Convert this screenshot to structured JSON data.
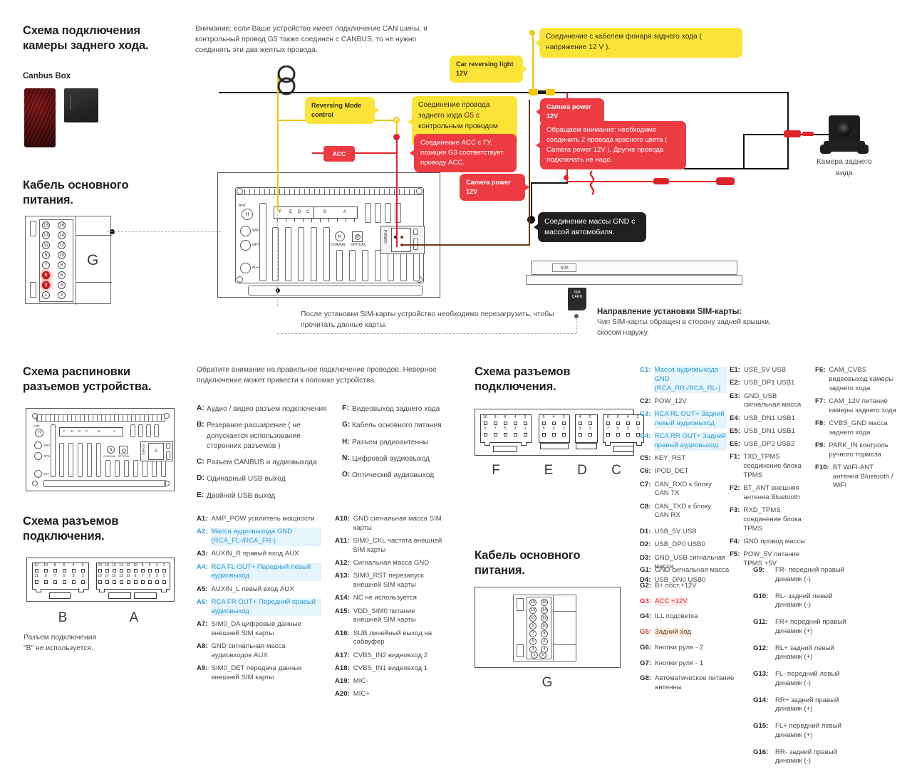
{
  "sections": {
    "rear_camera": {
      "title": "Схема подключения\nкамеры заднего хода.",
      "canbus_label": "Canbus Box",
      "warning": "Внимание: если Ваше устройство имеет подключение CAN шины, и контрольный провод G5 также соединен с CANBUS, то не нужно соединять эти два желтых провода.",
      "camera_caption": "Камера заднего\nвида"
    },
    "main_power_cable_top": {
      "title": "Кабель основного\nпитания.",
      "connector_letter": "G"
    },
    "sim": {
      "note": "После установки SIM-карты устройство необходимо перезагрузить, чтобы прочитать данные карты.",
      "direction_title": "Направление установки SIM-карты:",
      "direction_text": "Чип SIM-карты обращен в сторону задней крышки, скосом наружу.",
      "tray_label": "SIM",
      "chip_label": "SIM\nCARD"
    },
    "pinout": {
      "title": "Схема распиновки\nразъемов устройства.",
      "note": "Обратите внимание на правильное подключение проводов. Неверное подключение может привести к поломке устройства."
    },
    "connectors_right": {
      "title": "Схема разъемов\nподключения.",
      "letters": [
        "F",
        "E",
        "D",
        "C"
      ]
    },
    "connectors_left": {
      "title": "Схема разъемов\nподключения.",
      "letters": [
        "B",
        "A"
      ],
      "footnote": "Разъем подключения\n\"B\" не используется."
    },
    "main_power_cable_bottom": {
      "title": "Кабель основного\nпитания.",
      "connector_letter": "G"
    }
  },
  "callouts": {
    "reverse_lamp_12v": "Соединение с кабелем фонаря заднего хода ( напряжение 12 V ).",
    "car_reversing_light": "Car reversing light 12V",
    "reversing_mode_control": "Reversing Mode control",
    "g5_control_wire": "Соединение провода заднего хода G5 с контрольным проводом заднего хода.",
    "acc_note": "Соединение ACC с ГУ, позиция G3 соответствует проводу ACC.",
    "acc_tag": "ACC",
    "camera_power_top": "Camera power 12V",
    "camera_power_bottom": "Camera power 12V",
    "two_red_wires": "Обращаем внимание: необходимо соединить 2 провода красного цвета ( Camera power 12V ). Другие провода подключать не надо.",
    "gnd_note": "Соединение массы GND с массой автомобиля."
  },
  "device_labels": {
    "ant": "ANT",
    "antenna_pin": "H",
    "wifi": "WIFI",
    "gps": "GPS",
    "fourg": "4G+",
    "coaxial": "COAXIAL",
    "optical": "OPTICAL",
    "coaxial_pin": "N",
    "optical_pin": "O",
    "power": "POWER",
    "port_letters": [
      "F",
      "E",
      "D",
      "C",
      "B",
      "A"
    ]
  },
  "legend_abc": [
    {
      "key": "A:",
      "val": "Аудио / видео разъем подключения"
    },
    {
      "key": "B:",
      "val": "Резервное расширение ( не допускается использование сторонних разъемов )"
    },
    {
      "key": "C:",
      "val": "Разъем CANBUS и аудиовыхода"
    },
    {
      "key": "D:",
      "val": "Одинарный USB выход"
    },
    {
      "key": "E:",
      "val": "Двойной USB выход"
    }
  ],
  "legend_fgh": [
    {
      "key": "F:",
      "val": "Видеовыход заднего хода"
    },
    {
      "key": "G:",
      "val": "Кабель основного питания"
    },
    {
      "key": "H:",
      "val": "Разъем радиоантенны"
    },
    {
      "key": "N:",
      "val": "Цифровой аудиовыход"
    },
    {
      "key": "O:",
      "val": "Оптический аудиовыход"
    }
  ],
  "pins_C_D": [
    {
      "key": "C1:",
      "val": "Масса аудиовыхода GND (RCA_RR-/RCA_RL-)",
      "style": "hl"
    },
    {
      "key": "C2:",
      "val": "POW_12V",
      "style": ""
    },
    {
      "key": "C3:",
      "val": "RCA RL OUT+ Задний левый аудиовыход",
      "style": "hl"
    },
    {
      "key": "C4:",
      "val": "RCA RR OUT+ Задний правый аудиовыход",
      "style": "hl"
    },
    {
      "key": "C5:",
      "val": "KEY_RST",
      "style": ""
    },
    {
      "key": "C6:",
      "val": "IPOD_DET",
      "style": ""
    },
    {
      "key": "C7:",
      "val": "CAN_RXD к блоку CAN TX",
      "style": ""
    },
    {
      "key": "C8:",
      "val": "CAN_TXD к блоку CAN RX",
      "style": ""
    },
    {
      "key": "D1:",
      "val": "USB_5V USB",
      "style": ""
    },
    {
      "key": "D2:",
      "val": "USB_DP0 USB0",
      "style": ""
    },
    {
      "key": "D3:",
      "val": "GND_USB сигнальная масса",
      "style": ""
    },
    {
      "key": "D4:",
      "val": "USB_DN0 USB0",
      "style": ""
    }
  ],
  "pins_E_F": [
    {
      "key": "E1:",
      "val": "USB_5V USB",
      "style": ""
    },
    {
      "key": "E2:",
      "val": "USB_DP1 USB1",
      "style": ""
    },
    {
      "key": "E3:",
      "val": "GND_USB сигнальная масса",
      "style": ""
    },
    {
      "key": "E4:",
      "val": "USB_DN1 USB1",
      "style": ""
    },
    {
      "key": "E5:",
      "val": "USB_DN1 USB1",
      "style": ""
    },
    {
      "key": "E6:",
      "val": "USB_DP2 USB2",
      "style": ""
    },
    {
      "key": "F1:",
      "val": "TXD_TPMS соединение блока TPMS",
      "style": ""
    },
    {
      "key": "F2:",
      "val": "BT_ANT внешняя антенна Bluetooth",
      "style": ""
    },
    {
      "key": "F3:",
      "val": "RXD_TPMS соединение блока TPMS",
      "style": ""
    },
    {
      "key": "F4:",
      "val": "GND провод массы",
      "style": ""
    },
    {
      "key": "F5:",
      "val": "POW_5V питание TPMS +5V",
      "style": ""
    }
  ],
  "pins_F_right": [
    {
      "key": "F6:",
      "val": "CAM_CVBS видеовыход камеры заднего хода",
      "style": ""
    },
    {
      "key": "F7:",
      "val": "CAM_12V питание камеры заднего хода",
      "style": ""
    },
    {
      "key": "F8:",
      "val": "CVBS_GND масса заднего хода",
      "style": ""
    },
    {
      "key": "F9:",
      "val": "PARK_IN контроль ручного тормоза",
      "style": ""
    },
    {
      "key": "F10:",
      "val": "BT WIFI-ANT антенна Bluetooth / WiFi",
      "style": ""
    }
  ],
  "pins_A_left": [
    {
      "key": "A1:",
      "val": "AMP_POW усилитель мощности",
      "style": ""
    },
    {
      "key": "A2:",
      "val": "Масса аудиовыхода GND (RCA_FL-/RCA_FR-)",
      "style": "hl"
    },
    {
      "key": "A3:",
      "val": "AUXIN_R правый вход AUX",
      "style": ""
    },
    {
      "key": "A4:",
      "val": "RCA FL OUT+ Передний левый аудиовыход",
      "style": "hl"
    },
    {
      "key": "A5:",
      "val": "AUXIN_L левый вход AUX",
      "style": ""
    },
    {
      "key": "A6:",
      "val": "RCA FR OUT+ Передний правый аудиовыход",
      "style": "hl"
    },
    {
      "key": "A7:",
      "val": "SIM0_DA цифровые данные внешней SIM карты",
      "style": ""
    },
    {
      "key": "A8:",
      "val": "GND сигнальная масса аудиовходов AUX",
      "style": ""
    },
    {
      "key": "A9:",
      "val": "SIM0_DET передача данных внешней SIM карты",
      "style": ""
    }
  ],
  "pins_A_right": [
    {
      "key": "A10:",
      "val": "GND сигнальная масса SIM карты",
      "style": ""
    },
    {
      "key": "A11:",
      "val": "SIM0_CKL частота внешней SIM карты",
      "style": ""
    },
    {
      "key": "A12:",
      "val": "Сигнальная масса GND",
      "style": ""
    },
    {
      "key": "A13:",
      "val": "SIM0_RST перезапуск внешней SIM карты",
      "style": ""
    },
    {
      "key": "A14:",
      "val": "NC  не используется",
      "style": ""
    },
    {
      "key": "A15:",
      "val": "VDD_SIM0 питание внешней SIM карты",
      "style": ""
    },
    {
      "key": "A16:",
      "val": "SUB линейный выход на сабвуфер",
      "style": ""
    },
    {
      "key": "A17:",
      "val": "CVBS_IN2 видеовход 2",
      "style": ""
    },
    {
      "key": "A18:",
      "val": "CVBS_IN1 видеовход 1",
      "style": ""
    },
    {
      "key": "A19:",
      "val": "MIC-",
      "style": ""
    },
    {
      "key": "A20:",
      "val": "MIC+",
      "style": ""
    }
  ],
  "pins_G_left": [
    {
      "key": "G1:",
      "val": "GND сигнальная масса",
      "style": ""
    },
    {
      "key": "G2:",
      "val": "B+ пост.+12V",
      "style": ""
    },
    {
      "key": "G3:",
      "val": "ACC +12V",
      "style": "red"
    },
    {
      "key": "G4:",
      "val": "ILL подсветка",
      "style": ""
    },
    {
      "key": "G5:",
      "val": "Задний ход",
      "style": "redplain"
    },
    {
      "key": "G6:",
      "val": "Кнопки руля - 2",
      "style": ""
    },
    {
      "key": "G7:",
      "val": "Кнопки руля - 1",
      "style": ""
    },
    {
      "key": "G8:",
      "val": "Автоматическое питание антенны",
      "style": ""
    }
  ],
  "pins_G_right": [
    {
      "key": "G9:",
      "val": "FR- передний правый динамик (-)",
      "style": ""
    },
    {
      "key": "G10:",
      "val": "RL- задний левый динамик (-)",
      "style": ""
    },
    {
      "key": "G11:",
      "val": "FR+ передний правый динамик (+)",
      "style": ""
    },
    {
      "key": "G12:",
      "val": "RL+ задний левый динамик (+)",
      "style": ""
    },
    {
      "key": "G13:",
      "val": "FL- передний левый динамик (-)",
      "style": ""
    },
    {
      "key": "G14:",
      "val": "RR+ задний правый динамик (+)",
      "style": ""
    },
    {
      "key": "G15:",
      "val": "FL+ передний левый динамик (+)",
      "style": ""
    },
    {
      "key": "G16:",
      "val": "RR- задний правый динамик (-)",
      "style": ""
    }
  ],
  "pin_numbers": {
    "g_left_col": [
      "15",
      "13",
      "11",
      "9",
      "7",
      "5",
      "3",
      "1"
    ],
    "g_right_col": [
      "16",
      "14",
      "12",
      "10",
      "8",
      "6",
      "4",
      "2"
    ],
    "highlighted": [
      "5",
      "3"
    ],
    "conn_F_top": [
      "10",
      "8",
      "6",
      "4",
      "2"
    ],
    "conn_F_bottom": [
      "9",
      "7",
      "5",
      "3",
      "1"
    ],
    "conn_E_top": [
      "6",
      "4",
      "2"
    ],
    "conn_E_bottom": [
      "5",
      "3",
      "1"
    ],
    "conn_D_top": [
      "4",
      "2"
    ],
    "conn_D_bottom": [
      "3",
      "1"
    ],
    "conn_C_top": [
      "8",
      "6",
      "4",
      "2"
    ],
    "conn_C_bottom": [
      "7",
      "5",
      "3",
      "1"
    ],
    "conn_B_top": [
      "12",
      "10",
      "8",
      "6",
      "4",
      "2"
    ],
    "conn_B_bottom": [
      "11",
      "9",
      "7",
      "5",
      "3",
      "1"
    ],
    "conn_A_top": [
      "20",
      "18",
      "16",
      "14",
      "12",
      "10",
      "8",
      "6",
      "4",
      "2"
    ],
    "conn_A_bottom": [
      "19",
      "17",
      "15",
      "13",
      "11",
      "9",
      "7",
      "5",
      "3",
      "1"
    ]
  },
  "colors": {
    "yellow": "#fbe338",
    "red": "#ed3b43",
    "wire_yellow": "#f3c70a",
    "wire_red": "#e02229",
    "black": "#221f1f",
    "blue_text": "#2e9cd6",
    "red_text": "#e02229"
  }
}
